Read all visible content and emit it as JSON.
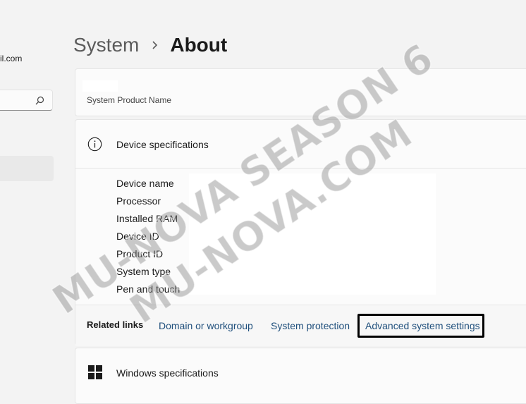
{
  "account": {
    "email_fragment": "il.com"
  },
  "search": {
    "placeholder": ""
  },
  "breadcrumb": {
    "parent": "System",
    "current": "About"
  },
  "product": {
    "caption": "System Product Name"
  },
  "device_specs": {
    "title": "Device specifications",
    "fields": [
      "Device name",
      "Processor",
      "Installed RAM",
      "Device ID",
      "Product ID",
      "System type",
      "Pen and touch"
    ]
  },
  "related": {
    "label": "Related links",
    "links": [
      "Domain or workgroup",
      "System protection",
      "Advanced system settings"
    ]
  },
  "windows_specs": {
    "title": "Windows specifications"
  },
  "watermark": {
    "line1": "MU-NOVA SEASON 6",
    "line2": "MU-NOVA.COM"
  },
  "colors": {
    "background": "#f3f3f3",
    "card": "#fbfbfb",
    "link": "#1f4f7c",
    "highlight": "#000000"
  }
}
